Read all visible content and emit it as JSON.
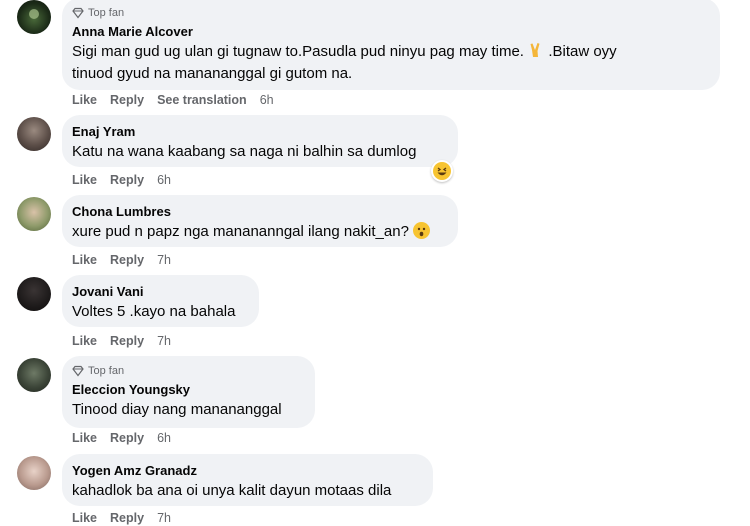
{
  "comments": [
    {
      "badge": "Top fan",
      "author": "Anna Marie Alcover",
      "text_line1": "Sigi man gud ug ulan gi tugnaw to.Pasudla pud ninyu pag may time.",
      "text_line1b": ".Bitaw oyy",
      "text_line2": "tinuod gyud na manananggal gi gutom na.",
      "like": "Like",
      "reply": "Reply",
      "translate": "See translation",
      "time": "6h"
    },
    {
      "author": "Enaj Yram",
      "text": "Katu na wana kaabang sa naga ni balhin sa dumlog",
      "like": "Like",
      "reply": "Reply",
      "time": "6h",
      "reaction": "haha-reaction"
    },
    {
      "author": "Chona Lumbres",
      "text": "xure pud n papz nga manananngal ilang nakit_an?",
      "like": "Like",
      "reply": "Reply",
      "time": "7h"
    },
    {
      "author": "Jovani Vani",
      "text": "Voltes 5 .kayo na bahala",
      "like": "Like",
      "reply": "Reply",
      "time": "7h"
    },
    {
      "badge": "Top fan",
      "author": "Eleccion Youngsky",
      "text": "Tinood diay nang manananggal",
      "like": "Like",
      "reply": "Reply",
      "time": "6h"
    },
    {
      "author": "Yogen Amz Granadz",
      "text": "kahadlok ba ana oi unya kalit dayun motaas dila",
      "like": "Like",
      "reply": "Reply",
      "time": "7h"
    }
  ],
  "colors": {
    "bubble": "#f0f2f5",
    "meta": "#65676b",
    "text": "#050505",
    "emoji": "#f7c431"
  }
}
